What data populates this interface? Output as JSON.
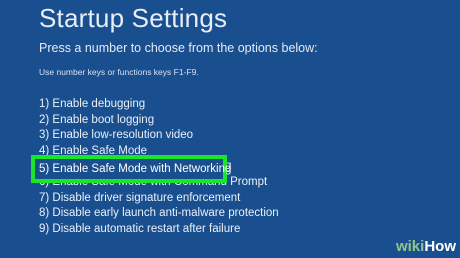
{
  "title": "Startup Settings",
  "prompt": "Press a number to choose from the options below:",
  "hint": "Use number keys or functions keys F1-F9.",
  "options": [
    "1) Enable debugging",
    "2) Enable boot logging",
    "3) Enable low-resolution video",
    "4) Enable Safe Mode",
    "5) Enable Safe Mode with Networking",
    "6) Enable Safe Mode with Command Prompt",
    "7) Disable driver signature enforcement",
    "8) Disable early launch anti-malware protection",
    "9) Disable automatic restart after failure"
  ],
  "selected_index": 4,
  "highlight_color": "#19e62a",
  "background_color": "#1a4f8f",
  "watermark": {
    "part1": "wiki",
    "part2": "How"
  }
}
